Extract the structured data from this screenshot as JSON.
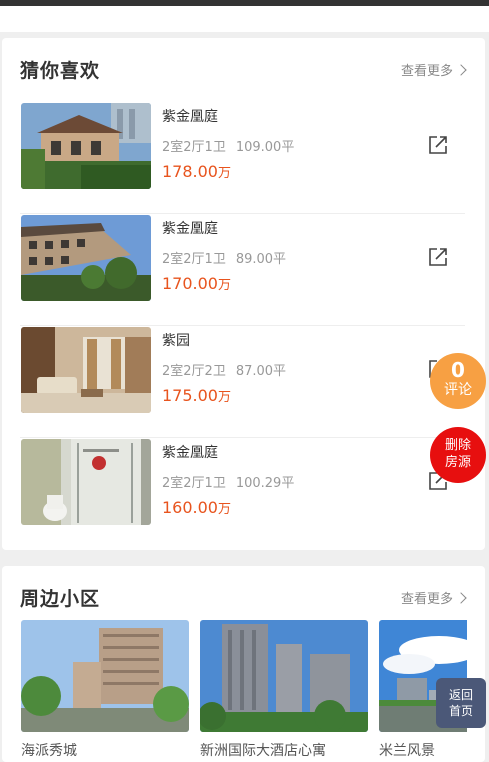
{
  "guess": {
    "title": "猜你喜欢",
    "more": "查看更多",
    "items": [
      {
        "name": "紫金凰庭",
        "layout": "2室2厅1卫",
        "area": "109.00平",
        "price": "178.00",
        "unit": "万"
      },
      {
        "name": "紫金凰庭",
        "layout": "2室2厅1卫",
        "area": "89.00平",
        "price": "170.00",
        "unit": "万"
      },
      {
        "name": "紫园",
        "layout": "2室2厅2卫",
        "area": "87.00平",
        "price": "175.00",
        "unit": "万"
      },
      {
        "name": "紫金凰庭",
        "layout": "2室2厅1卫",
        "area": "100.29平",
        "price": "160.00",
        "unit": "万"
      }
    ]
  },
  "nearby": {
    "title": "周边小区",
    "more": "查看更多",
    "items": [
      {
        "name": "海派秀城"
      },
      {
        "name": "新洲国际大酒店心寓"
      },
      {
        "name": "米兰风景"
      }
    ]
  },
  "fabs": {
    "comment_count": "0",
    "comment_label": "评论",
    "delete_line1": "删除",
    "delete_line2": "房源",
    "home_line1": "返回",
    "home_line2": "首页"
  },
  "colors": {
    "price": "#e8541e",
    "comment_fab": "#f7a043",
    "delete_fab": "#e70f0f",
    "home_fab": "#4b5878"
  }
}
